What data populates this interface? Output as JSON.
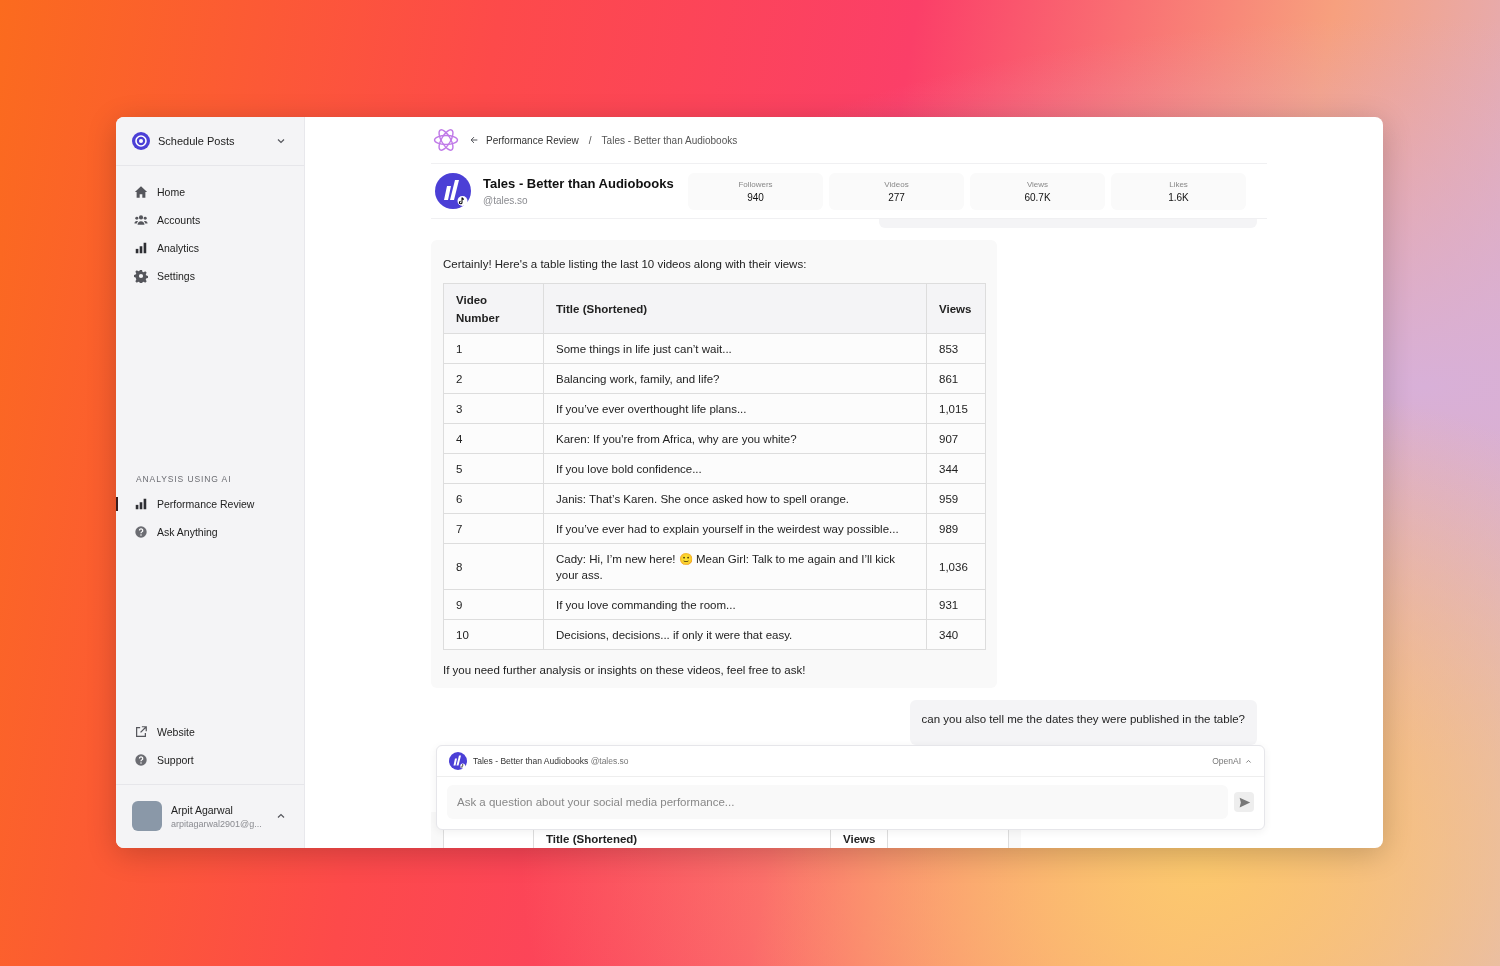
{
  "workspace": {
    "label": "Schedule Posts"
  },
  "nav": [
    {
      "label": "Home",
      "kind": "home",
      "selected": false
    },
    {
      "label": "Accounts",
      "kind": "users",
      "selected": false
    },
    {
      "label": "Analytics",
      "kind": "bars",
      "selected": false
    },
    {
      "label": "Settings",
      "kind": "gear",
      "selected": false
    }
  ],
  "ai_section": {
    "heading": "ANALYSIS USING AI",
    "items": [
      {
        "label": "Performance Review",
        "kind": "bars",
        "selected": true
      },
      {
        "label": "Ask Anything",
        "kind": "help",
        "selected": false
      }
    ]
  },
  "footer_links": [
    {
      "label": "Website",
      "kind": "external"
    },
    {
      "label": "Support",
      "kind": "help"
    }
  ],
  "user": {
    "name": "Arpit Agarwal",
    "email": "arpitagarwal2901@g..."
  },
  "breadcrumb": {
    "back": "Performance Review",
    "separator": "/",
    "current": "Tales - Better than Audiobooks"
  },
  "account": {
    "name": "Tales - Better than Audiobooks",
    "handle": "@tales.so"
  },
  "stats": [
    {
      "label": "Followers",
      "value": "940"
    },
    {
      "label": "Videos",
      "value": "277"
    },
    {
      "label": "Views",
      "value": "60.7K"
    },
    {
      "label": "Likes",
      "value": "1.6K"
    }
  ],
  "assistant_message": {
    "intro": "Certainly! Here's a table listing the last 10 videos along with their views:",
    "columns": [
      "Video Number",
      "Title (Shortened)",
      "Views"
    ],
    "rows": [
      [
        "1",
        "Some things in life just can’t wait...",
        "853"
      ],
      [
        "2",
        "Balancing work, family, and life?",
        "861"
      ],
      [
        "3",
        "If you’ve ever overthought life plans...",
        "1,015"
      ],
      [
        "4",
        "Karen: If you're from Africa, why are you white?",
        "907"
      ],
      [
        "5",
        "If you love bold confidence...",
        "344"
      ],
      [
        "6",
        "Janis: That’s Karen. She once asked how to spell orange.",
        "959"
      ],
      [
        "7",
        "If you’ve ever had to explain yourself in the weirdest way possible...",
        "989"
      ],
      [
        "8",
        "Cady: Hi, I’m new here! 🙂 Mean Girl: Talk to me again and I’ll kick your ass.",
        "1,036"
      ],
      [
        "9",
        "If you love commanding the room...",
        "931"
      ],
      [
        "10",
        "Decisions, decisions... if only it were that easy.",
        "340"
      ]
    ],
    "outro": "If you need further analysis or insights on these videos, feel free to ask!"
  },
  "user_message": "can you also tell me the dates they were published in the table?",
  "next_table_columns": [
    "Title (Shortened)",
    "Views"
  ],
  "composer": {
    "account": "Tales - Better than Audiobooks",
    "handle": "@tales.so",
    "model": "OpenAI",
    "placeholder": "Ask a question about your social media performance..."
  }
}
